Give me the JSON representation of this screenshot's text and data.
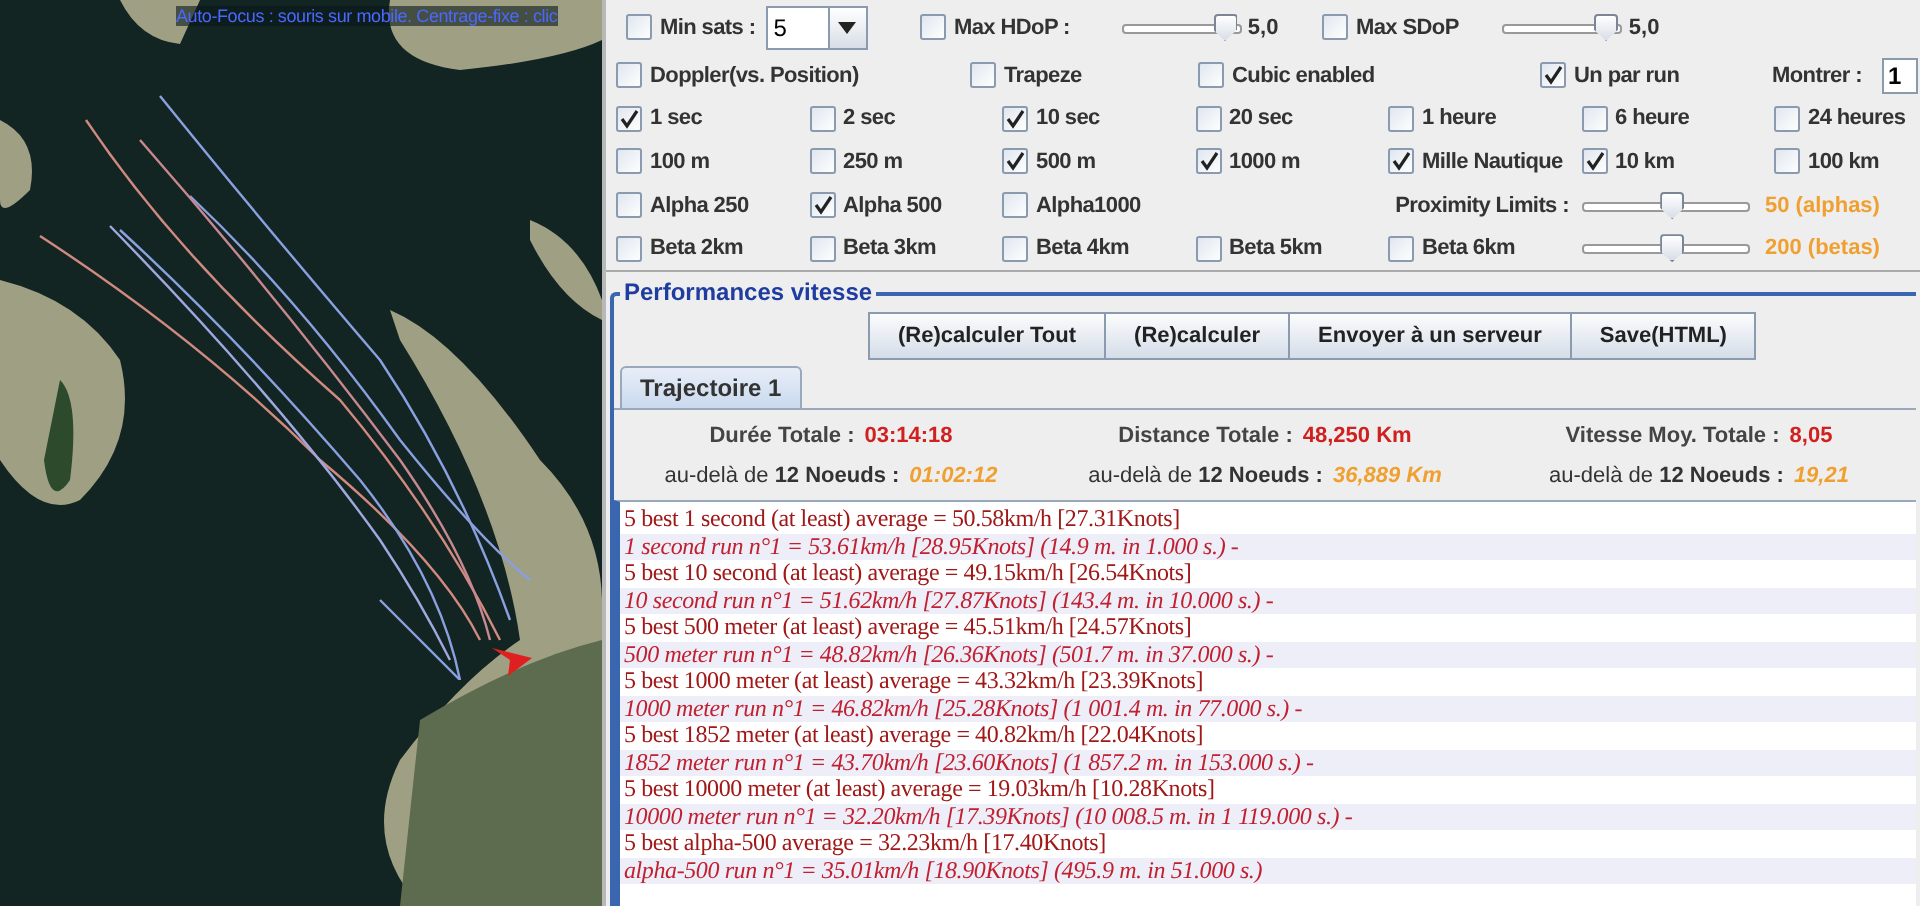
{
  "map": {
    "caption": "Auto-Focus : souris sur mobile. Centrage-fixe : clic"
  },
  "filters": [
    {
      "kind": "dropdown",
      "label": "Min sats :",
      "checked": false,
      "value": "5"
    },
    {
      "kind": "slider",
      "label": "Max HDoP :",
      "checked": false,
      "level": 0.95,
      "reading": "5,0"
    },
    {
      "kind": "slider",
      "label": "Max SDoP",
      "checked": false,
      "level": 0.95,
      "reading": "5,0"
    }
  ],
  "option_rows": [
    [
      {
        "kind": "checkbox",
        "label": "Doppler(vs. Position)",
        "checked": false
      },
      {
        "kind": "checkbox",
        "label": "Trapeze",
        "checked": false
      },
      {
        "kind": "checkbox",
        "label": "Cubic enabled",
        "checked": false
      },
      {
        "kind": "checkbox",
        "label": "Un par run",
        "checked": true
      },
      {
        "kind": "field",
        "label": "Montrer :",
        "value": "1"
      }
    ],
    [
      {
        "kind": "checkbox",
        "label": "1 sec",
        "checked": true
      },
      {
        "kind": "checkbox",
        "label": "2 sec",
        "checked": false
      },
      {
        "kind": "checkbox",
        "label": "10 sec",
        "checked": true
      },
      {
        "kind": "checkbox",
        "label": "20 sec",
        "checked": false
      },
      {
        "kind": "checkbox",
        "label": "1 heure",
        "checked": false
      },
      {
        "kind": "checkbox",
        "label": "6 heure",
        "checked": false
      },
      {
        "kind": "checkbox",
        "label": "24 heures",
        "checked": false
      }
    ],
    [
      {
        "kind": "checkbox",
        "label": "100 m",
        "checked": false
      },
      {
        "kind": "checkbox",
        "label": "250 m",
        "checked": false
      },
      {
        "kind": "checkbox",
        "label": "500 m",
        "checked": true
      },
      {
        "kind": "checkbox",
        "label": "1000 m",
        "checked": true
      },
      {
        "kind": "checkbox",
        "label": "Mille Nautique",
        "checked": true
      },
      {
        "kind": "checkbox",
        "label": "10 km",
        "checked": true
      },
      {
        "kind": "checkbox",
        "label": "100 km",
        "checked": false
      }
    ],
    [
      {
        "kind": "checkbox",
        "label": "Alpha 250",
        "checked": false
      },
      {
        "kind": "checkbox",
        "label": "Alpha 500",
        "checked": true
      },
      {
        "kind": "checkbox",
        "label": "Alpha1000",
        "checked": false
      },
      {
        "kind": "label",
        "label": "Proximity Limits :"
      },
      {
        "kind": "slider",
        "level": 0.55,
        "reading": "50 (alphas)"
      }
    ],
    [
      {
        "kind": "checkbox",
        "label": "Beta 2km",
        "checked": false
      },
      {
        "kind": "checkbox",
        "label": "Beta 3km",
        "checked": false
      },
      {
        "kind": "checkbox",
        "label": "Beta 4km",
        "checked": false
      },
      {
        "kind": "checkbox",
        "label": "Beta 5km",
        "checked": false
      },
      {
        "kind": "checkbox",
        "label": "Beta 6km",
        "checked": false
      },
      {
        "kind": "slider",
        "level": 0.55,
        "reading": "200 (betas)"
      }
    ]
  ],
  "performance": {
    "title": "Performances vitesse",
    "buttons": [
      "(Re)calculer Tout",
      "(Re)calculer",
      "Envoyer à un serveur",
      "Save(HTML)"
    ],
    "tabs": [
      {
        "label": "Trajectoire 1",
        "selected": true
      }
    ],
    "totals": [
      {
        "label": "Durée Totale :",
        "value": "03:14:18"
      },
      {
        "label": "Distance Totale :",
        "value": "48,250 Km"
      },
      {
        "label": "Vitesse Moy. Totale :",
        "value": "8,05"
      }
    ],
    "beyond": [
      {
        "label": "au-delà de **12 Noeuds :**",
        "value": "01:02:12"
      },
      {
        "label": "au-delà de **12 Noeuds :**",
        "value": "36,889 Km"
      },
      {
        "label": "au-delà de **12 Noeuds :**",
        "value": "19,21"
      }
    ],
    "results": [
      {
        "kind": "summary",
        "text": "5 best 1 second (at least) average = 50.58km/h [27.31Knots]"
      },
      {
        "kind": "run",
        "text": "1 second run n°1 = 53.61km/h [28.95Knots] (14.9 m. in 1.000 s.) -"
      },
      {
        "kind": "summary",
        "text": "5 best 10 second (at least) average = 49.15km/h [26.54Knots]"
      },
      {
        "kind": "run",
        "text": "10 second run n°1 = 51.62km/h [27.87Knots] (143.4 m. in 10.000 s.) -"
      },
      {
        "kind": "summary",
        "text": "5 best 500 meter (at least) average = 45.51km/h [24.57Knots]"
      },
      {
        "kind": "run",
        "text": "500 meter run n°1 = 48.82km/h [26.36Knots] (501.7 m. in 37.000 s.) -"
      },
      {
        "kind": "summary",
        "text": "5 best 1000 meter (at least) average = 43.32km/h [23.39Knots]"
      },
      {
        "kind": "run",
        "text": "1000 meter run n°1 = 46.82km/h [25.28Knots] (1 001.4 m. in 77.000 s.) -"
      },
      {
        "kind": "summary",
        "text": "5 best 1852 meter (at least) average = 40.82km/h [22.04Knots]"
      },
      {
        "kind": "run",
        "text": "1852 meter run n°1 = 43.70km/h [23.60Knots] (1 857.2 m. in 153.000 s.) -"
      },
      {
        "kind": "summary",
        "text": "5 best 10000 meter (at least) average = 19.03km/h [10.28Knots]"
      },
      {
        "kind": "run",
        "text": "10000 meter run n°1 = 32.20km/h [17.39Knots] (10 008.5 m. in 1 119.000 s.) -"
      },
      {
        "kind": "summary",
        "text": "5 best alpha-500 average = 32.23km/h [17.40Knots]"
      },
      {
        "kind": "run",
        "text": "alpha-500 run n°1 = 35.01km/h [18.90Knots] (495.9 m. in 51.000 s.)"
      }
    ]
  }
}
